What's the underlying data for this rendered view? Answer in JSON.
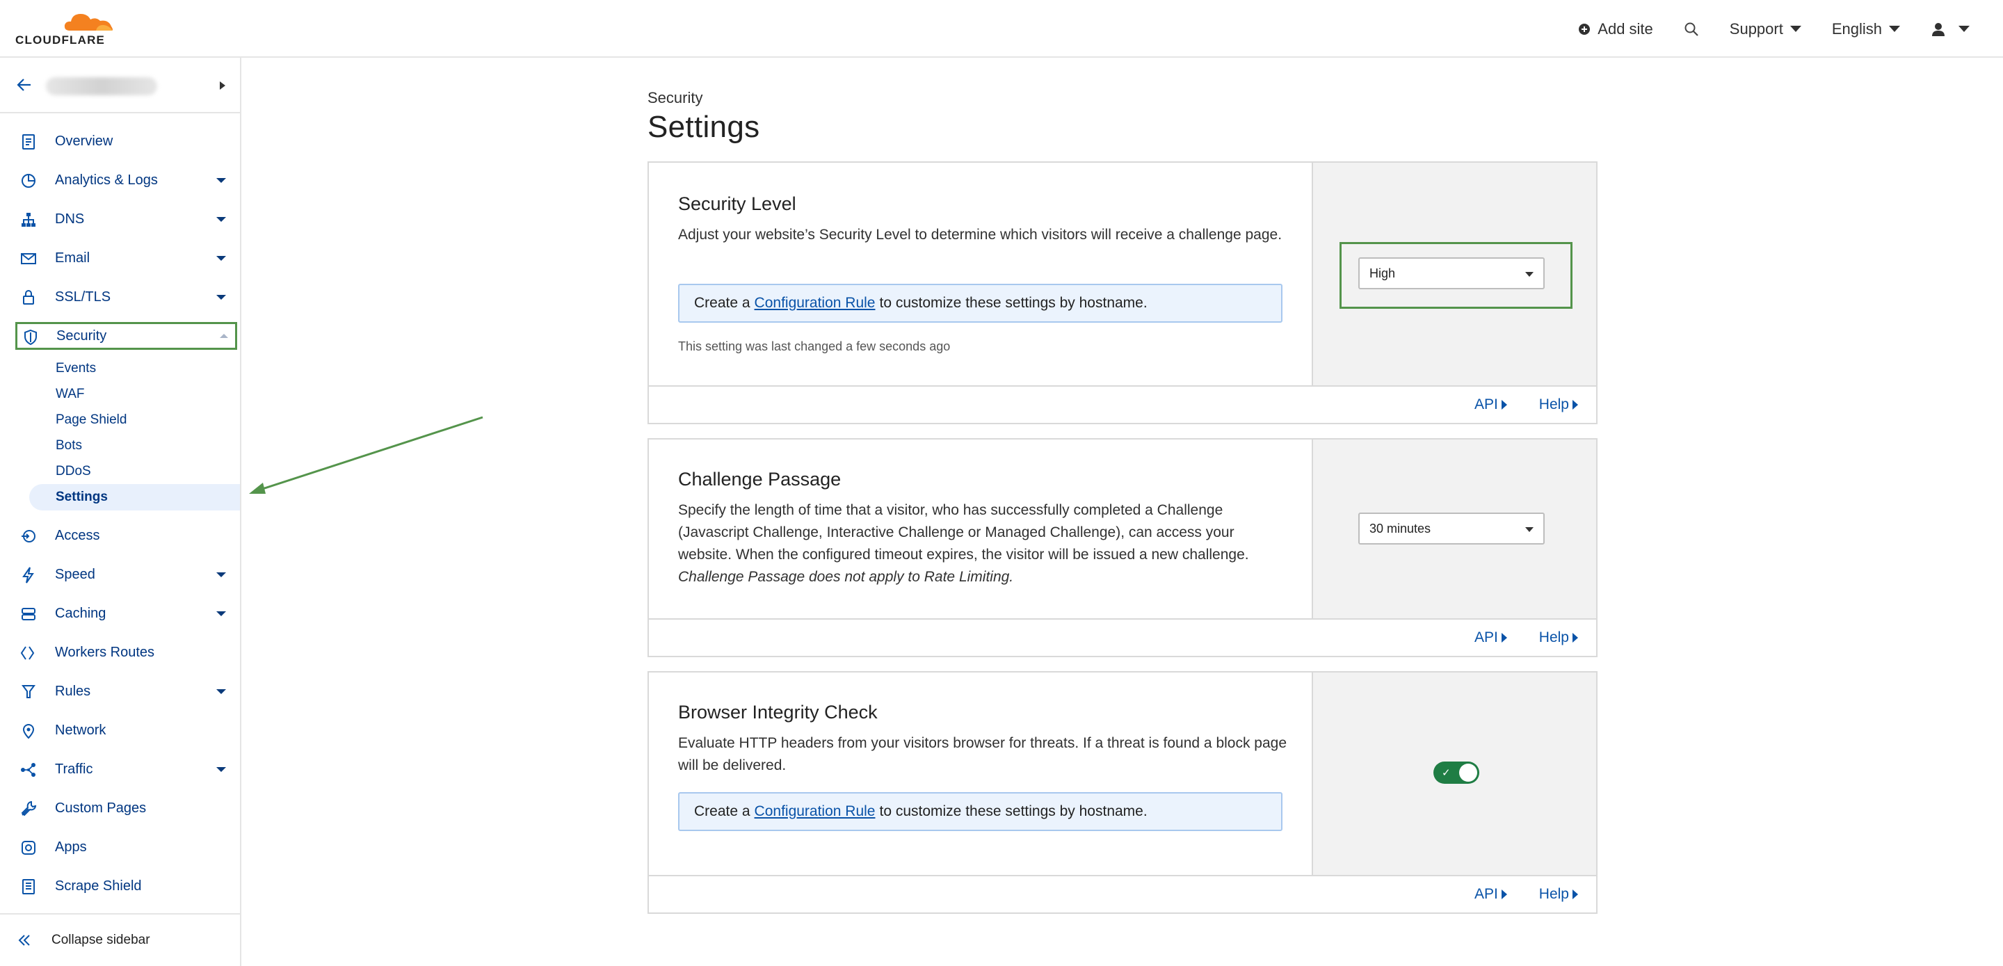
{
  "topbar": {
    "logo_text": "CLOUDFLARE",
    "add_site": "Add site",
    "support": "Support",
    "language": "English"
  },
  "sidebar": {
    "items": [
      {
        "label": "Overview",
        "icon": "document-icon"
      },
      {
        "label": "Analytics & Logs",
        "icon": "pie-chart-icon"
      },
      {
        "label": "DNS",
        "icon": "network-tree-icon"
      },
      {
        "label": "Email",
        "icon": "envelope-icon"
      },
      {
        "label": "SSL/TLS",
        "icon": "lock-icon"
      },
      {
        "label": "Security",
        "icon": "shield-icon"
      },
      {
        "label": "Access",
        "icon": "access-icon"
      },
      {
        "label": "Speed",
        "icon": "lightning-icon"
      },
      {
        "label": "Caching",
        "icon": "server-icon"
      },
      {
        "label": "Workers Routes",
        "icon": "workers-icon"
      },
      {
        "label": "Rules",
        "icon": "rules-icon"
      },
      {
        "label": "Network",
        "icon": "location-pin-icon"
      },
      {
        "label": "Traffic",
        "icon": "traffic-icon"
      },
      {
        "label": "Custom Pages",
        "icon": "wrench-icon"
      },
      {
        "label": "Apps",
        "icon": "apps-icon"
      },
      {
        "label": "Scrape Shield",
        "icon": "scrape-shield-icon"
      }
    ],
    "security_sub": [
      "Events",
      "WAF",
      "Page Shield",
      "Bots",
      "DDoS",
      "Settings"
    ],
    "collapse": "Collapse sidebar"
  },
  "main": {
    "breadcrumb": "Security",
    "title": "Settings",
    "security_level": {
      "title": "Security Level",
      "desc": "Adjust your website’s Security Level to determine which visitors will receive a challenge page.",
      "cfg_pre": "Create a",
      "cfg_link": "Configuration Rule",
      "cfg_post": "to customize these settings by hostname.",
      "changed": "This setting was last changed a few seconds ago",
      "value": "High"
    },
    "challenge_passage": {
      "title": "Challenge Passage",
      "desc": "Specify the length of time that a visitor, who has successfully completed a Challenge (Javascript Challenge, Interactive Challenge or Managed Challenge), can access your website. When the configured timeout expires, the visitor will be issued a new challenge.",
      "desc_italic": "Challenge Passage does not apply to Rate Limiting.",
      "value": "30 minutes"
    },
    "browser_integrity": {
      "title": "Browser Integrity Check",
      "desc": "Evaluate HTTP headers from your visitors browser for threats. If a threat is found a block page will be delivered.",
      "cfg_pre": "Create a",
      "cfg_link": "Configuration Rule",
      "cfg_post": "to customize these settings by hostname.",
      "enabled": true
    },
    "api_label": "API",
    "help_label": "Help"
  },
  "colors": {
    "accent": "#0a53a8",
    "highlight": "#54944b",
    "toggle_on": "#1f7d44",
    "logo_orange": "#f48120"
  }
}
